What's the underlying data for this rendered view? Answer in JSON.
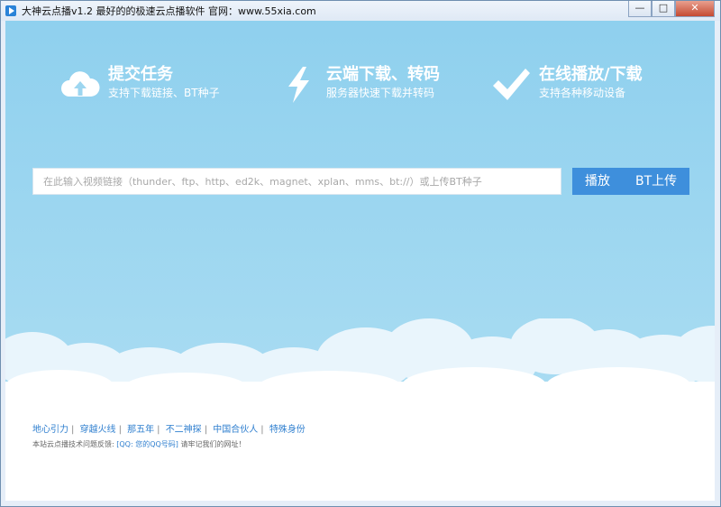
{
  "window": {
    "title": "大神云点播v1.2  最好的的极速云点播软件  官网：www.55xia.com",
    "controls": {
      "minimize": "—",
      "maximize": "□",
      "close": "✕"
    }
  },
  "features": [
    {
      "icon": "cloud-upload-icon",
      "title": "提交任务",
      "subtitle": "支持下载链接、BT种子"
    },
    {
      "icon": "lightning-icon",
      "title": "云端下载、转码",
      "subtitle": "服务器快速下载并转码"
    },
    {
      "icon": "checkmark-icon",
      "title": "在线播放/下载",
      "subtitle": "支持各种移动设备"
    }
  ],
  "search": {
    "placeholder": "在此输入视频链接（thunder、ftp、http、ed2k、magnet、xplan、mms、bt://）或上传BT种子",
    "play_label": "播放",
    "bt_upload_label": "BT上传"
  },
  "footer": {
    "links": [
      "地心引力",
      "穿越火线",
      "那五年",
      "不二神探",
      "中国合伙人",
      "特殊身份"
    ],
    "note_prefix": "本站云点播技术问题反馈:",
    "note_qq": "[QQ: 您的QQ号码]",
    "note_suffix": "请牢记我们的网址！"
  },
  "colors": {
    "sky": "#8fd0ee",
    "button": "#3e8fdc",
    "link": "#2f7fcf"
  }
}
